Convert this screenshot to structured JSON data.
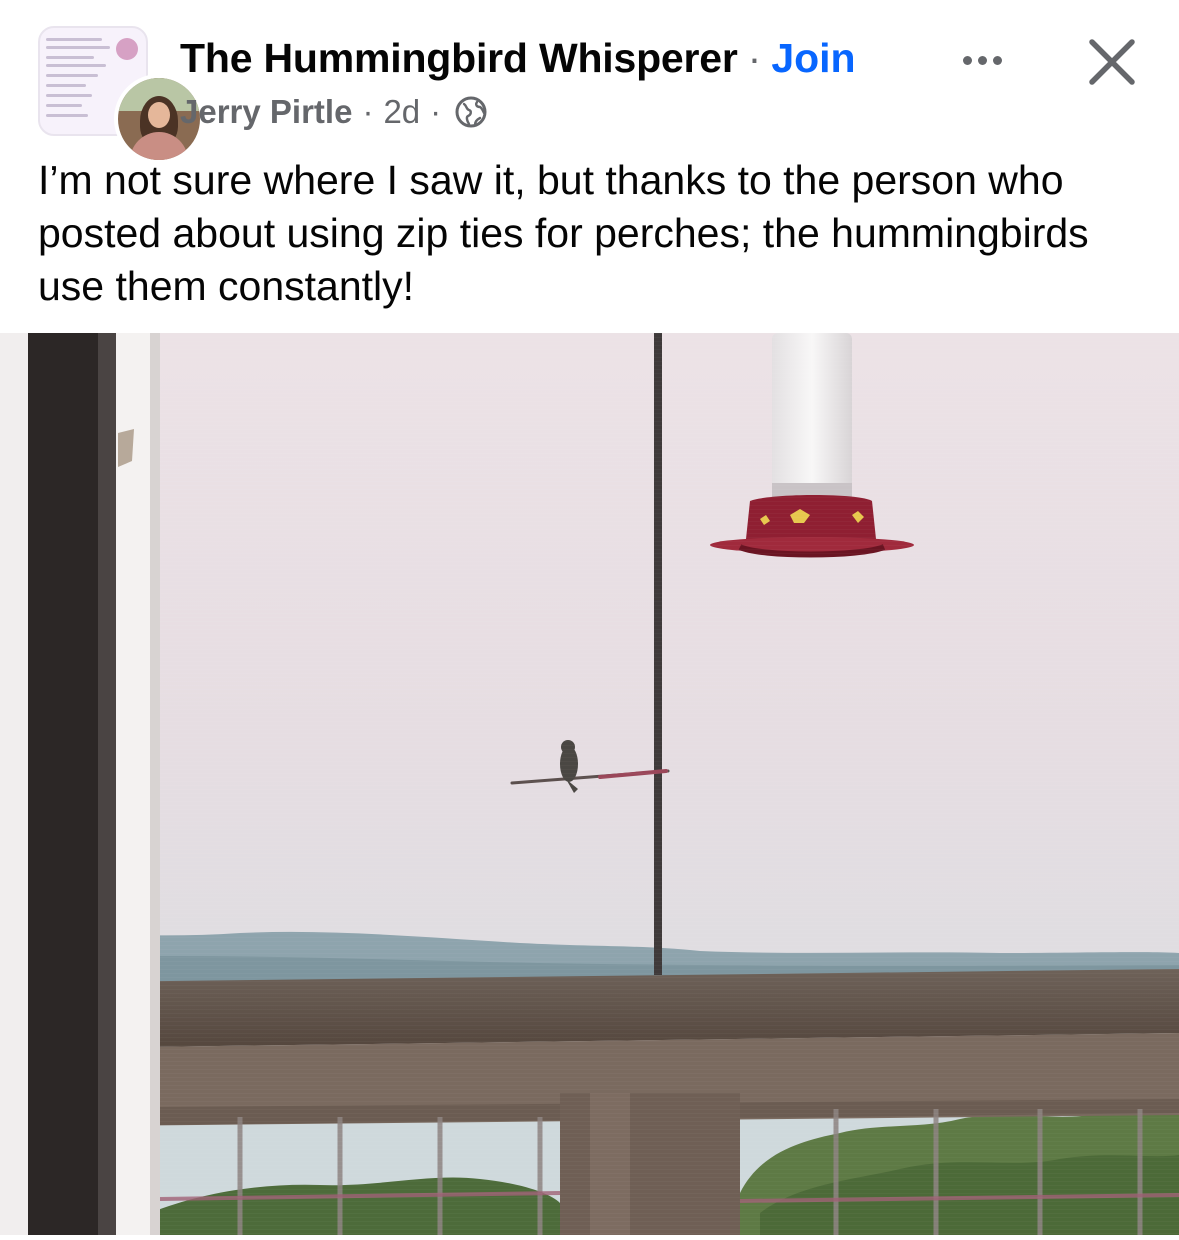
{
  "post": {
    "group_name": "The Hummingbird Whisperer",
    "separator": "·",
    "join_label": "Join",
    "author": "Jerry Pirtle",
    "time": "2d",
    "body_text": "I’m not sure where I saw it, but thanks to the person who posted about using zip ties for perches; the hummingbirds use them constantly!"
  },
  "icons": {
    "audience": "globe-icon",
    "more": "more-options-icon",
    "close": "close-icon"
  },
  "colors": {
    "link_blue": "#0866ff",
    "secondary_text": "#65676b",
    "primary_text": "#050505"
  }
}
